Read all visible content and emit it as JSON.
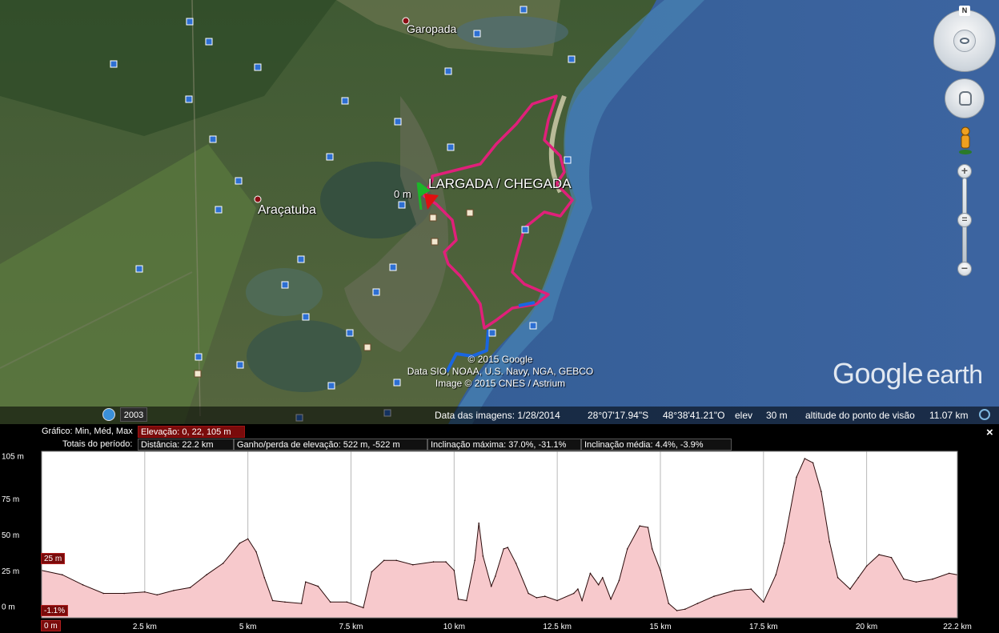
{
  "map": {
    "towns": [
      "Garopada",
      "Araçatuba"
    ],
    "route_label": "LARGADA / CHEGADA",
    "route_distance_marker": "0 m",
    "attribution": [
      "© 2015 Google",
      "Data SIO, NOAA, U.S. Navy, NGA, GEBCO",
      "Image © 2015 CNES / Astrium"
    ],
    "logo": {
      "google": "Google",
      "earth": "earth"
    },
    "north_label": "N",
    "route_color": "#e0207a",
    "route_secondary_color": "#1a66e0"
  },
  "statusbar": {
    "history_year": "2003",
    "imagery_date": "Data das imagens: 1/28/2014",
    "latitude": "28°07'17.94\"S",
    "longitude": "48°38'41.21\"O",
    "elev_label": "elev",
    "elev_value": "30 m",
    "eye_alt_label": "altitude do ponto de visão",
    "eye_alt_value": "11.07 km"
  },
  "profile": {
    "row1_label": "Gráfico:",
    "row1_options": [
      "Min, Méd, Max"
    ],
    "elevation_box": "Elevação: 0, 22, 105 m",
    "row2_label": "Totais do período:",
    "stats": [
      "Distância: 22.2 km",
      "Ganho/perda de elevação: 522 m, -522 m",
      "Inclinação máxima: 37.0%, -31.1%",
      "Inclinação média: 4.4%, -3.9%"
    ],
    "close": "×",
    "cursor_elev_flag": "25 m",
    "cursor_slope_flag": "-1.1%",
    "cursor_dist_flag": "0 m"
  },
  "chart_data": {
    "type": "area",
    "xlabel": "",
    "ylabel": "",
    "xlim": [
      0,
      22.2
    ],
    "ylim": [
      -8,
      108
    ],
    "y_ticks": [
      {
        "v": 0,
        "label": "0 m"
      },
      {
        "v": 25,
        "label": "25 m"
      },
      {
        "v": 50,
        "label": "50 m"
      },
      {
        "v": 75,
        "label": "75 m"
      },
      {
        "v": 105,
        "label": "105 m"
      }
    ],
    "x_ticks": [
      {
        "v": 2.5,
        "label": "2.5 km"
      },
      {
        "v": 5,
        "label": "5 km"
      },
      {
        "v": 7.5,
        "label": "7.5 km"
      },
      {
        "v": 10,
        "label": "10 km"
      },
      {
        "v": 12.5,
        "label": "12.5 km"
      },
      {
        "v": 15,
        "label": "15 km"
      },
      {
        "v": 17.5,
        "label": "17.5 km"
      },
      {
        "v": 20,
        "label": "20 km"
      },
      {
        "v": 22.2,
        "label": "22.2 km"
      }
    ],
    "fill_color": "#f7c9cc",
    "line_color": "#2a0a0a",
    "series": [
      {
        "x": [
          0,
          0.5,
          1.0,
          1.5,
          2.0,
          2.5,
          2.8,
          3.2,
          3.6,
          4.0,
          4.4,
          4.8,
          5.0,
          5.2,
          5.4,
          5.6,
          5.9,
          6.3,
          6.4,
          6.7,
          7.0,
          7.4,
          7.8,
          8.0,
          8.3,
          8.6,
          9.0,
          9.5,
          9.8,
          10.0,
          10.1,
          10.3,
          10.5,
          10.6,
          10.7,
          10.9,
          11.0,
          11.2,
          11.3,
          11.5,
          11.8,
          12.0,
          12.2,
          12.5,
          12.9,
          13.0,
          13.1,
          13.3,
          13.5,
          13.6,
          13.8,
          14.0,
          14.2,
          14.5,
          14.7,
          14.8,
          15.0,
          15.2,
          15.4,
          15.6,
          15.9,
          16.3,
          16.8,
          17.2,
          17.5,
          17.8,
          18.0,
          18.3,
          18.5,
          18.7,
          18.9,
          19.1,
          19.3,
          19.6,
          19.8,
          20.0,
          20.3,
          20.6,
          20.9,
          21.2,
          21.6,
          22.0,
          22.2
        ],
        "values": [
          25,
          22,
          15,
          9,
          9,
          10,
          8,
          11,
          13,
          22,
          30,
          44,
          47,
          38,
          20,
          4,
          3,
          2,
          17,
          14,
          3,
          3,
          -1,
          24,
          32,
          32,
          29,
          31,
          31,
          25,
          5,
          4,
          32,
          58,
          35,
          14,
          21,
          40,
          41,
          30,
          9,
          6,
          7,
          4,
          9,
          12,
          4,
          23,
          15,
          20,
          5,
          18,
          40,
          56,
          55,
          40,
          25,
          2,
          -3,
          -2,
          2,
          7,
          11,
          12,
          3,
          22,
          44,
          90,
          103,
          100,
          80,
          45,
          20,
          12,
          20,
          28,
          36,
          34,
          19,
          17,
          19,
          23,
          22
        ]
      }
    ]
  }
}
